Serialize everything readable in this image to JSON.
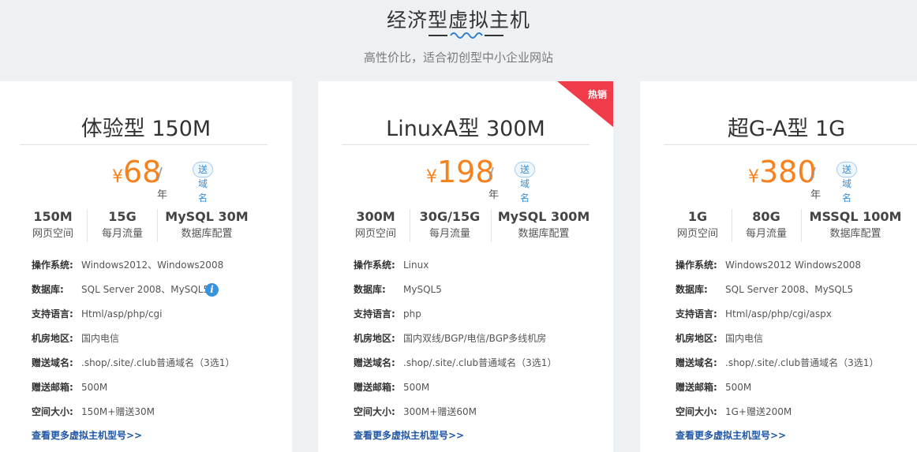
{
  "header": {
    "title": "经济型虚拟主机",
    "subtitle": "高性价比，适合初创型中小企业网站"
  },
  "colors": {
    "accent": "#f7821d",
    "link": "#1e56a8",
    "badge": "#3a8ed6",
    "hot": "#f03c4a"
  },
  "labels": {
    "currency": "¥",
    "per_year": "年",
    "slash": "/",
    "badge": "送域名",
    "more_link": "查看更多虚拟主机型号>>",
    "hot": "热销",
    "info_icon": "i"
  },
  "cards": [
    {
      "title": "体验型 150M",
      "price": "68",
      "stats": [
        {
          "value": "150M",
          "label": "网页空间"
        },
        {
          "value": "15G",
          "label": "每月流量"
        },
        {
          "value": "MySQL 30M",
          "label": "数据库配置"
        }
      ],
      "specs": [
        {
          "key": "操作系统:",
          "value": "Windows2012、Windows2008"
        },
        {
          "key": "数据库:",
          "value": "SQL Server 2008、MySQL5"
        },
        {
          "key": "支持语言:",
          "value": "Html/asp/php/cgi"
        },
        {
          "key": "机房地区:",
          "value": "国内电信"
        },
        {
          "key": "赠送域名:",
          "value": ".shop/.site/.club普通域名（3选1）"
        },
        {
          "key": "赠送邮箱:",
          "value": "500M"
        },
        {
          "key": "空间大小:",
          "value": "150M+赠送30M"
        }
      ]
    },
    {
      "title": "LinuxA型 300M",
      "price": "198",
      "stats": [
        {
          "value": "300M",
          "label": "网页空间"
        },
        {
          "value": "30G/15G",
          "label": "每月流量"
        },
        {
          "value": "MySQL 300M",
          "label": "数据库配置"
        }
      ],
      "specs": [
        {
          "key": "操作系统:",
          "value": "Linux"
        },
        {
          "key": "数据库:",
          "value": "MySQL5"
        },
        {
          "key": "支持语言:",
          "value": "php"
        },
        {
          "key": "机房地区:",
          "value": "国内双线/BGP/电信/BGP多线机房"
        },
        {
          "key": "赠送域名:",
          "value": ".shop/.site/.club普通域名（3选1）"
        },
        {
          "key": "赠送邮箱:",
          "value": "500M"
        },
        {
          "key": "空间大小:",
          "value": "300M+赠送60M"
        }
      ]
    },
    {
      "title": "超G-A型 1G",
      "price": "380",
      "stats": [
        {
          "value": "1G",
          "label": "网页空间"
        },
        {
          "value": "80G",
          "label": "每月流量"
        },
        {
          "value": "MSSQL 100M",
          "label": "数据库配置"
        }
      ],
      "specs": [
        {
          "key": "操作系统:",
          "value": "Windows2012 Windows2008"
        },
        {
          "key": "数据库:",
          "value": "SQL Server 2008、MySQL5"
        },
        {
          "key": "支持语言:",
          "value": "Html/asp/php/cgi/aspx"
        },
        {
          "key": "机房地区:",
          "value": "国内电信"
        },
        {
          "key": "赠送域名:",
          "value": ".shop/.site/.club普通域名（3选1）"
        },
        {
          "key": "赠送邮箱:",
          "value": "500M"
        },
        {
          "key": "空间大小:",
          "value": "1G+赠送200M"
        }
      ]
    }
  ]
}
